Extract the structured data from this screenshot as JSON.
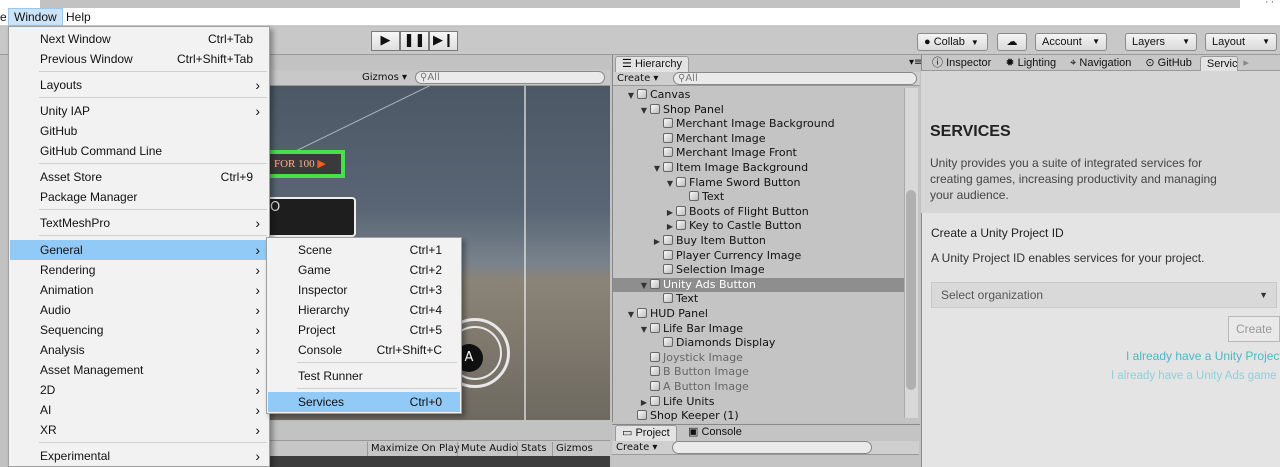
{
  "menubar": {
    "window": "Window",
    "help": "Help"
  },
  "toolbar": {
    "play_icon": "play-icon",
    "pause_icon": "pause-icon",
    "step_icon": "step-icon",
    "collab": "Collab",
    "account": "Account",
    "layers": "Layers",
    "layout": "Layout"
  },
  "scene": {
    "gizmos": "Gizmos",
    "search_placeholder": "All",
    "button_text": "FOR 100",
    "bottom_buttons": [
      "Maximize On Play",
      "Mute Audio",
      "Stats",
      "Gizmos"
    ]
  },
  "hierarchy": {
    "tab": "Hierarchy",
    "create": "Create",
    "search_placeholder": "All",
    "rows": [
      {
        "label": "Canvas"
      },
      {
        "label": "Shop Panel"
      },
      {
        "label": "Merchant Image Background"
      },
      {
        "label": "Merchant Image"
      },
      {
        "label": "Merchant Image Front"
      },
      {
        "label": "Item Image Background"
      },
      {
        "label": "Flame Sword Button"
      },
      {
        "label": "Text"
      },
      {
        "label": "Boots of Flight Button"
      },
      {
        "label": "Key to Castle Button"
      },
      {
        "label": "Buy Item Button"
      },
      {
        "label": "Player Currency Image"
      },
      {
        "label": "Selection Image"
      },
      {
        "label": "Unity Ads Button"
      },
      {
        "label": "Text"
      },
      {
        "label": "HUD Panel"
      },
      {
        "label": "Life Bar Image"
      },
      {
        "label": "Diamonds Display"
      },
      {
        "label": "Joystick Image"
      },
      {
        "label": "B Button Image"
      },
      {
        "label": "A Button Image"
      },
      {
        "label": "Life Units"
      },
      {
        "label": "Shop Keeper (1)"
      }
    ]
  },
  "inspector": {
    "tabs": [
      "Inspector",
      "Lighting",
      "Navigation",
      "GitHub",
      "Servic"
    ],
    "services_title": "SERVICES",
    "services_desc": "Unity provides you a suite of integrated services for creating games, increasing productivity and managing your audience.",
    "create_id_title": "Create a Unity Project ID",
    "create_id_desc": "A Unity Project ID enables services for your project.",
    "select_org": "Select organization",
    "create_button": "Create",
    "link1": "I already have a Unity Project ID",
    "link2": "I already have a Unity Ads game ID"
  },
  "project": {
    "tabs": [
      "Project",
      "Console"
    ],
    "create": "Create"
  },
  "window_menu": [
    {
      "label": "Next Window",
      "shortcut": "Ctrl+Tab"
    },
    {
      "label": "Previous Window",
      "shortcut": "Ctrl+Shift+Tab"
    },
    {
      "label": "Layouts",
      "sub": true
    },
    {
      "label": "Unity IAP",
      "sub": true
    },
    {
      "label": "GitHub"
    },
    {
      "label": "GitHub Command Line"
    },
    {
      "label": "Asset Store",
      "shortcut": "Ctrl+9"
    },
    {
      "label": "Package Manager"
    },
    {
      "label": "TextMeshPro",
      "sub": true
    },
    {
      "label": "General",
      "sub": true
    },
    {
      "label": "Rendering",
      "sub": true
    },
    {
      "label": "Animation",
      "sub": true
    },
    {
      "label": "Audio",
      "sub": true
    },
    {
      "label": "Sequencing",
      "sub": true
    },
    {
      "label": "Analysis",
      "sub": true
    },
    {
      "label": "Asset Management",
      "sub": true
    },
    {
      "label": "2D",
      "sub": true
    },
    {
      "label": "AI",
      "sub": true
    },
    {
      "label": "XR",
      "sub": true
    },
    {
      "label": "Experimental",
      "sub": true
    }
  ],
  "general_menu": [
    {
      "label": "Scene",
      "shortcut": "Ctrl+1"
    },
    {
      "label": "Game",
      "shortcut": "Ctrl+2"
    },
    {
      "label": "Inspector",
      "shortcut": "Ctrl+3"
    },
    {
      "label": "Hierarchy",
      "shortcut": "Ctrl+4"
    },
    {
      "label": "Project",
      "shortcut": "Ctrl+5"
    },
    {
      "label": "Console",
      "shortcut": "Ctrl+Shift+C"
    },
    {
      "label": "Test Runner"
    },
    {
      "label": "Services",
      "shortcut": "Ctrl+0"
    }
  ],
  "colors": {
    "menu_highlight": "#91c9f7",
    "link": "#4fb6c6"
  }
}
